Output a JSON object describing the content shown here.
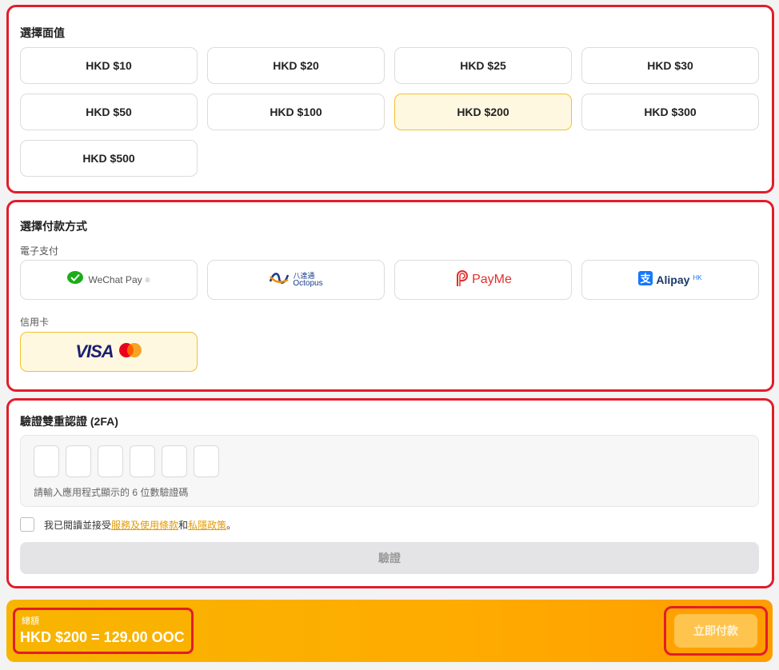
{
  "denomination": {
    "title": "選擇面值",
    "options": [
      "HKD $10",
      "HKD $20",
      "HKD $25",
      "HKD $30",
      "HKD $50",
      "HKD $100",
      "HKD $200",
      "HKD $300",
      "HKD $500"
    ],
    "selected": "HKD $200"
  },
  "payment": {
    "title": "選擇付款方式",
    "ewallet_label": "電子支付",
    "ewallets": [
      {
        "name": "WeChat Pay",
        "icon": "wechat-pay-icon",
        "color": "#1aad19"
      },
      {
        "name": "Octopus",
        "cn_name": "八達通",
        "icon": "octopus-icon",
        "color": "#1a3a8a"
      },
      {
        "name": "PayMe",
        "icon": "payme-icon",
        "color": "#e0312b"
      },
      {
        "name": "Alipay",
        "suffix": "HK",
        "icon": "alipay-icon",
        "color": "#1677ff"
      }
    ],
    "card_label": "信用卡",
    "card": {
      "name": "VISA",
      "icon": "visa-mastercard-icon",
      "color": "#1a1f71"
    },
    "selected": "card"
  },
  "twofa": {
    "title": "驗證雙重認證 (2FA)",
    "digit_count": 6,
    "hint": "請輸入應用程式顯示的 6 位數驗證碼",
    "agree_prefix": "我已閱讀並接受",
    "terms_link": "服務及使用條款",
    "and_text": "和",
    "privacy_link": "私隱政策",
    "agree_suffix": "。",
    "verify_label": "驗證"
  },
  "footer": {
    "total_label": "總額",
    "total_value": "HKD $200 = 129.00 OOC",
    "pay_label": "立即付款"
  },
  "colors": {
    "accent": "#f2c12e",
    "highlight": "#e11d2a",
    "link": "#e59a00"
  }
}
